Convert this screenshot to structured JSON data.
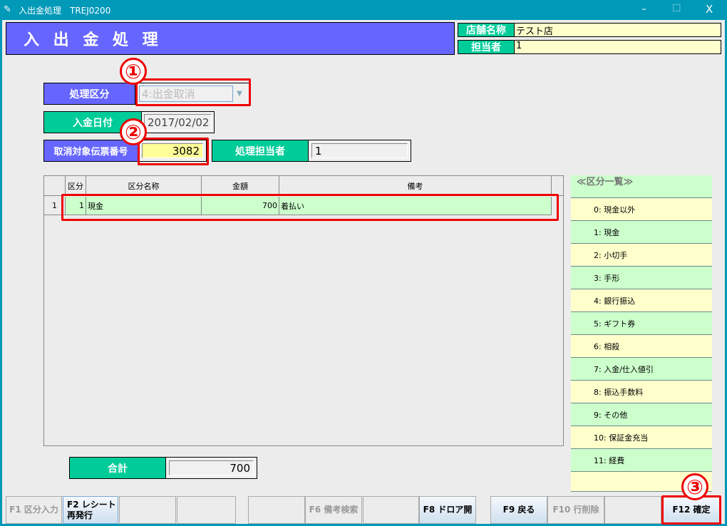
{
  "window": {
    "title": "入出金処理　TREJ0200",
    "minimize": "–",
    "maximize": "☐",
    "close": "X"
  },
  "header": {
    "title": "入 出 金 処 理",
    "store_label": "店舗名称",
    "store_value": "テスト店",
    "staff_label": "担当者",
    "staff_value": "1"
  },
  "form": {
    "type_label": "処理区分",
    "type_value": "4:出金取消",
    "date_label": "入金日付",
    "date_value": "2017/02/02",
    "slip_label": "取消対象伝票番号",
    "slip_value": "3082",
    "handler_label": "処理担当者",
    "handler_value": "1"
  },
  "grid": {
    "headers": [
      "",
      "区分",
      "区分名称",
      "金額",
      "備考"
    ],
    "rows": [
      {
        "no": "1",
        "code": "1",
        "name": "現金",
        "amount": "700",
        "note": "着払い"
      }
    ]
  },
  "category_list": {
    "title": "≪区分一覧≫",
    "items": [
      "0: 現金以外",
      "1: 現金",
      "2: 小切手",
      "3: 手形",
      "4: 銀行振込",
      "5: ギフト券",
      "6: 相殺",
      "7: 入金/仕入値引",
      "8: 振込手数料",
      "9: その他",
      "10: 保証金充当",
      "11: 経費"
    ]
  },
  "total": {
    "label": "合計",
    "value": "700"
  },
  "annotations": [
    "①",
    "②",
    "③"
  ],
  "fkeys": {
    "f1": "F1 区分入力",
    "f2a": "F2 レシート",
    "f2b": "再発行",
    "f6": "F6 備考検索",
    "f8": "F8 ドロア開",
    "f9": "F9 戻る",
    "f10": "F10 行削除",
    "f12": "F12 確定"
  }
}
